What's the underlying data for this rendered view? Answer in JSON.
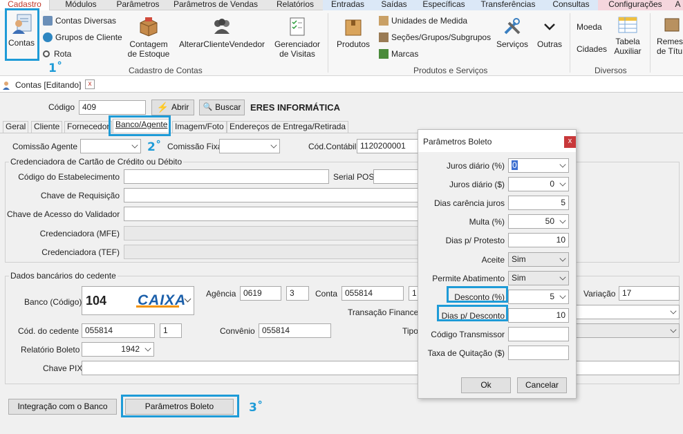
{
  "menu": {
    "tabs": [
      "Cadastro",
      "Módulos",
      "Parâmetros",
      "Parâmetros de Vendas",
      "Relatórios",
      "Entradas",
      "Saídas",
      "Específicas",
      "Transferências",
      "Consultas",
      "Configurações",
      "A"
    ]
  },
  "ribbon": {
    "cadastro": {
      "contas": "Contas",
      "contas_diversas": "Contas Diversas",
      "grupos_cliente": "Grupos de Cliente",
      "rota": "Rota",
      "contagem_estoque_1": "Contagem",
      "contagem_estoque_2": "de Estoque",
      "alterar_cliente_vendedor": "AlterarClienteVendedor",
      "gerenciador_visitas_1": "Gerenciador",
      "gerenciador_visitas_2": "de Visitas",
      "group_label": "Cadastro de Contas"
    },
    "produtos": {
      "produtos": "Produtos",
      "unidades_medida": "Unidades de Medida",
      "secoes": "Seções/Grupos/Subgrupos",
      "marcas": "Marcas",
      "servicos": "Serviços",
      "outras": "Outras",
      "group_label": "Produtos e Serviços"
    },
    "diversos": {
      "moeda": "Moeda",
      "cidades": "Cidades",
      "tabela_auxiliar_1": "Tabela",
      "tabela_auxiliar_2": "Auxiliar",
      "group_label": "Diversos"
    },
    "remessa_1": "Remes",
    "remessa_2": "de Títu"
  },
  "steps": {
    "s1": "1˚",
    "s2": "2˚",
    "s3": "3˚"
  },
  "doc_tab": {
    "label": "Contas [Editando]",
    "close": "x"
  },
  "form": {
    "codigo_label": "Código",
    "codigo_value": "409",
    "abrir": "Abrir",
    "buscar": "Buscar",
    "company": "ERES INFORMÁTICA",
    "tabs": [
      "Geral",
      "Cliente",
      "Fornecedor",
      "Banco/Agente",
      "Imagem/Foto",
      "Endereços de Entrega/Retirada"
    ],
    "comissao_agente": "Comissão Agente",
    "comissao_fixa": "Comissão Fixa",
    "cod_contabil": "Cód.Contábil",
    "cod_contabil_value": "1120200001",
    "credenciadora": {
      "title": "Credenciadora de Cartão de Crédito ou Débito",
      "cod_estab": "Código do Estabelecimento",
      "serial_pos": "Serial POS",
      "chave_req": "Chave de Requisição",
      "chave_acesso": "Chave de Acesso do Validador",
      "cred_mfe": "Credenciadora (MFE)",
      "cred_tef": "Credenciadora (TEF)"
    },
    "dados": {
      "title": "Dados bancários do cedente",
      "banco_label": "Banco (Código)",
      "banco_code": "104",
      "banco_logo": "CAIXA",
      "agencia": "Agência",
      "agencia_value": "0619",
      "agencia_dv": "3",
      "conta": "Conta",
      "conta_value": "055814",
      "conta_dv": "1",
      "variacao": "Variação",
      "variacao_value": "17",
      "transacao": "Transação Financeir",
      "cod_cedente": "Cód. do cedente",
      "cod_cedente_value": "055814",
      "cod_cedente_dv": "1",
      "convenio": "Convênio",
      "convenio_value": "055814",
      "tipo": "Tipo",
      "relatorio": "Relatório Boleto",
      "relatorio_value": "1942",
      "chave_pix": "Chave PIX"
    },
    "integracao_btn": "Integração com o Banco",
    "parametros_btn": "Parâmetros Boleto"
  },
  "dialog": {
    "title": "Parâmetros Boleto",
    "close": "x",
    "fields": {
      "juros_pct": {
        "label": "Juros diário (%)",
        "value": "0"
      },
      "juros_val": {
        "label": "Juros diário ($)",
        "value": "0"
      },
      "carencia": {
        "label": "Dias carência juros",
        "value": "5"
      },
      "multa": {
        "label": "Multa (%)",
        "value": "50"
      },
      "protesto": {
        "label": "Dias p/ Protesto",
        "value": "10"
      },
      "aceite": {
        "label": "Aceite",
        "value": "Sim"
      },
      "abatimento": {
        "label": "Permite Abatimento",
        "value": "Sim"
      },
      "desconto": {
        "label": "Desconto (%)",
        "value": "5"
      },
      "dias_desconto": {
        "label": "Dias p/ Desconto",
        "value": "10"
      },
      "transmissor": {
        "label": "Código Transmissor",
        "value": ""
      },
      "quitacao": {
        "label": "Taxa de Quitação ($)",
        "value": ""
      }
    },
    "ok": "Ok",
    "cancelar": "Cancelar"
  },
  "colors": {
    "highlight": "#1e9bd7",
    "active_tab": "#c0392b",
    "blue_tabs": "#dbe8f7",
    "pink_tab": "#f5d6dd"
  }
}
